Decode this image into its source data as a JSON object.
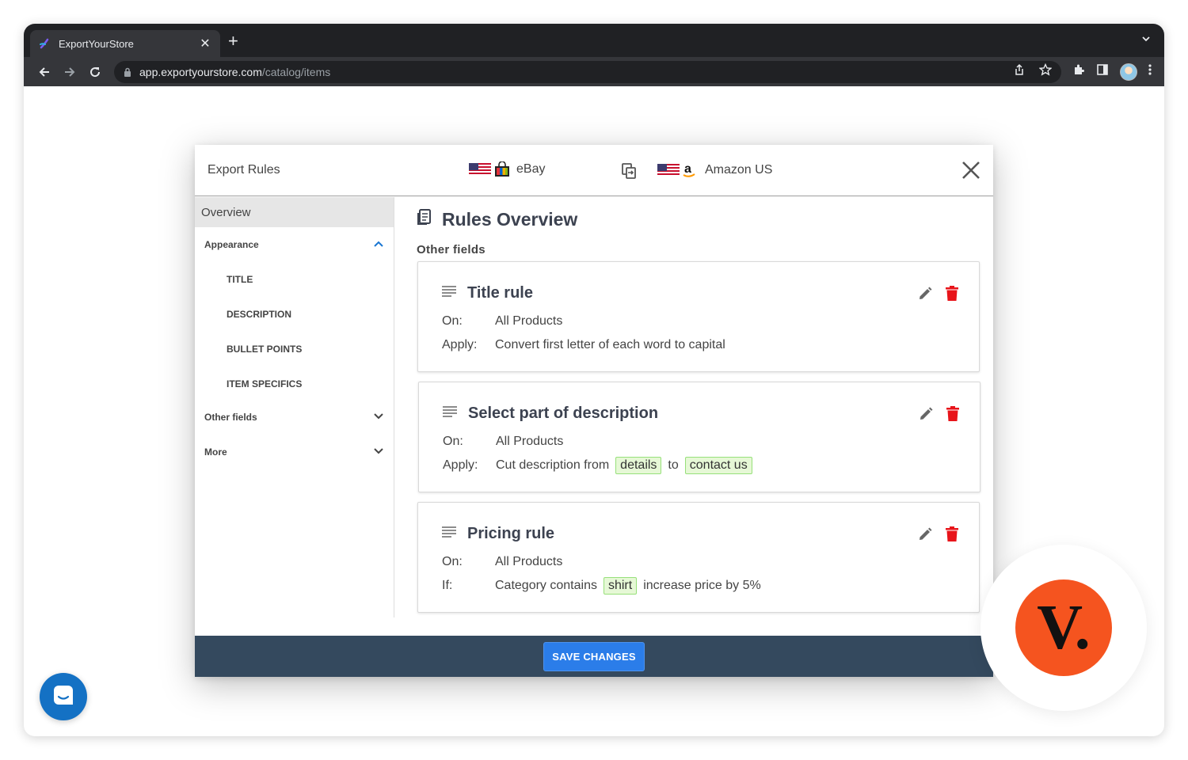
{
  "browser": {
    "tab_title": "ExportYourStore",
    "url_host": "app.exportyourstore.com",
    "url_path": "/catalog/items"
  },
  "modal": {
    "title": "Export Rules",
    "source_channel": "eBay",
    "target_channel": "Amazon US",
    "save_label": "SAVE CHANGES"
  },
  "sidebar": {
    "overview": "Overview",
    "appearance": "Appearance",
    "items": [
      "TITLE",
      "DESCRIPTION",
      "BULLET POINTS",
      "ITEM SPECIFICS"
    ],
    "other_fields": "Other fields",
    "more": "More"
  },
  "main": {
    "title": "Rules Overview",
    "section": "Other fields"
  },
  "rules": [
    {
      "title": "Title rule",
      "on_label": "On:",
      "on_value": "All Products",
      "apply_label": "Apply:",
      "apply_text": "Convert first letter of each word to capital"
    },
    {
      "title": "Select part of description",
      "on_label": "On:",
      "on_value": "All Products",
      "apply_label": "Apply:",
      "apply_prefix": "Cut description from",
      "chip1": "details",
      "connector": "to",
      "chip2": "contact us"
    },
    {
      "title": "Pricing rule",
      "on_label": "On:",
      "on_value": "All Products",
      "if_label": "If:",
      "if_prefix": "Category contains",
      "chip": "shirt",
      "if_suffix": "increase price by 5%"
    }
  ],
  "brand_badge": {
    "letter": "V."
  },
  "colors": {
    "footer": "#34495e",
    "save_button": "#2b7de9",
    "delete": "#e8141a",
    "chip_bg": "#e6f8d6",
    "chip_border": "#97e07a",
    "brand": "#f5541f",
    "chat": "#1471c4"
  }
}
